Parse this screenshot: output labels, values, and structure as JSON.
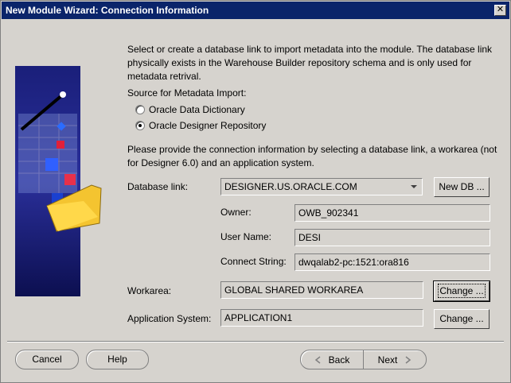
{
  "window": {
    "title": "New Module Wizard: Connection Information",
    "close_glyph": "✕"
  },
  "intro": "Select or create a database link to import metadata into the module.  The database link physically exists in the Warehouse Builder repository schema and is only used for metadata retrival.",
  "source": {
    "label": "Source for Metadata Import:",
    "options": [
      {
        "label": "Oracle Data Dictionary",
        "selected": false
      },
      {
        "label": "Oracle Designer Repository",
        "selected": true
      }
    ]
  },
  "instructions": "Please provide the connection information by selecting a database link, a workarea (not for Designer 6.0) and an application system.",
  "database_link": {
    "label": "Database link:",
    "value": "DESIGNER.US.ORACLE.COM",
    "new_button": "New DB ..."
  },
  "owner": {
    "label": "Owner:",
    "value": "OWB_902341"
  },
  "user_name": {
    "label": "User Name:",
    "value": "DESI"
  },
  "connect_string": {
    "label": "Connect String:",
    "value": "dwqalab2-pc:1521:ora816"
  },
  "workarea": {
    "label": "Workarea:",
    "value": "GLOBAL SHARED WORKAREA",
    "button": "Change ..."
  },
  "application_system": {
    "label": "Application System:",
    "value": "APPLICATION1",
    "button": "Change ..."
  },
  "footer": {
    "cancel": "Cancel",
    "help": "Help",
    "back": "Back",
    "next": "Next"
  }
}
